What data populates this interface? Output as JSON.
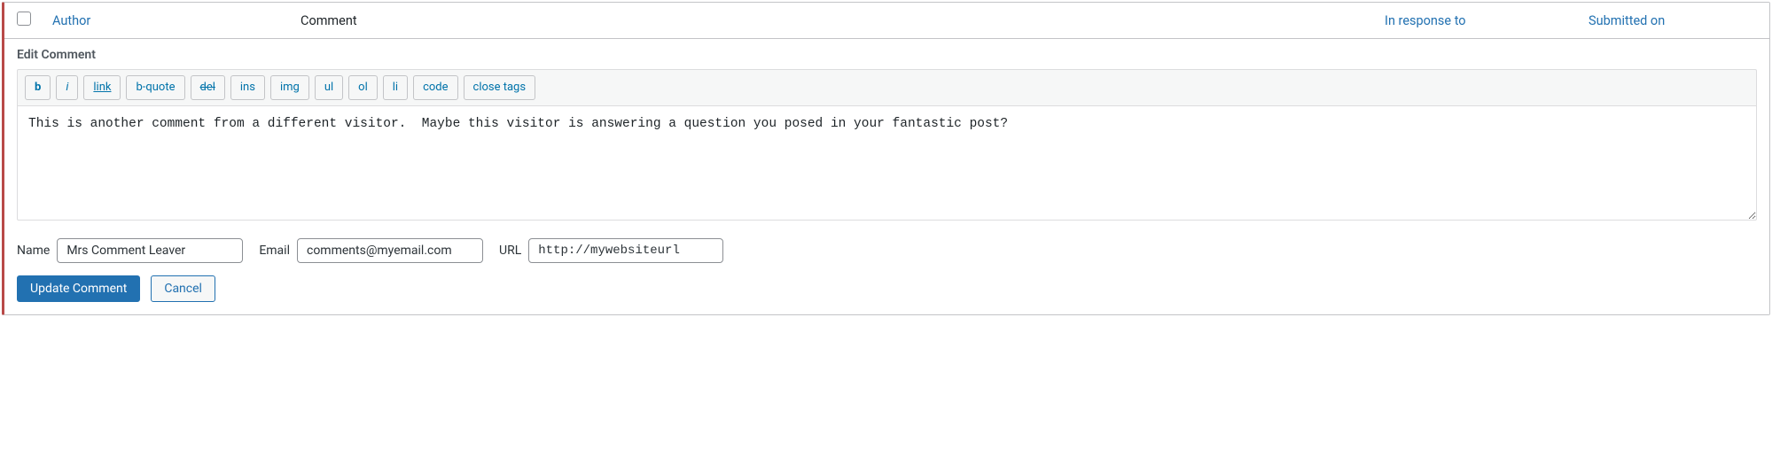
{
  "columns": {
    "author": "Author",
    "comment": "Comment",
    "response": "In response to",
    "submitted": "Submitted on"
  },
  "edit": {
    "title": "Edit Comment",
    "content": "This is another comment from a different visitor.  Maybe this visitor is answering a question you posed in your fantastic post?"
  },
  "quicktags": {
    "b": "b",
    "i": "i",
    "link": "link",
    "bquote": "b-quote",
    "del": "del",
    "ins": "ins",
    "img": "img",
    "ul": "ul",
    "ol": "ol",
    "li": "li",
    "code": "code",
    "close": "close tags"
  },
  "fields": {
    "name_label": "Name",
    "name_value": "Mrs Comment Leaver",
    "email_label": "Email",
    "email_value": "comments@myemail.com",
    "url_label": "URL",
    "url_value": "http://mywebsiteurl"
  },
  "actions": {
    "update": "Update Comment",
    "cancel": "Cancel"
  }
}
